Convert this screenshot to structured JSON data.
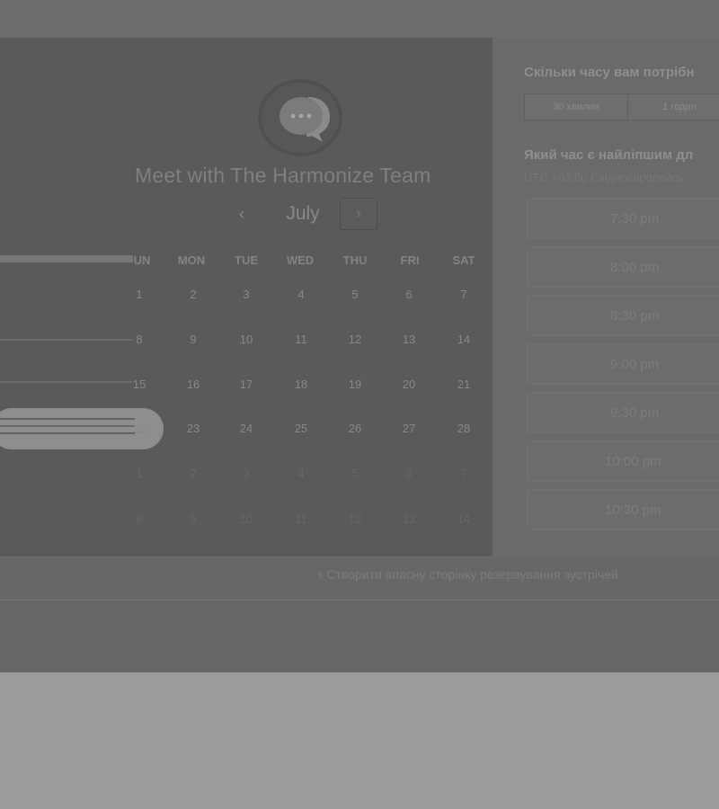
{
  "calendar": {
    "title": "Meet with The Harmonize Team",
    "month": "July",
    "prev_icon": "‹",
    "next_icon": "›",
    "weekdays": [
      "UN",
      "MON",
      "TUE",
      "WED",
      "THU",
      "FRI",
      "SAT"
    ],
    "weeks": [
      [
        "1",
        "2",
        "3",
        "4",
        "5",
        "6",
        "7"
      ],
      [
        "8",
        "9",
        "10",
        "11",
        "12",
        "13",
        "14"
      ],
      [
        "15",
        "16",
        "17",
        "18",
        "19",
        "20",
        "21"
      ],
      [
        "22",
        "23",
        "24",
        "25",
        "26",
        "27",
        "28"
      ],
      [
        "1",
        "2",
        "3",
        "4",
        "5",
        "6",
        "7"
      ],
      [
        "8",
        "9",
        "10",
        "11",
        "12",
        "13",
        "14"
      ]
    ],
    "selected_day": "22"
  },
  "booking": {
    "duration_question": "Скільки часу вам потрібн",
    "durations": [
      "30 хвилин",
      "1 годин"
    ],
    "time_question": "Який час є найліпшим дл",
    "timezone": "UTC +03:00 Східноєвропейсь",
    "slots": [
      "7:30 pm",
      "8:00 pm",
      "8:30 pm",
      "9:00 pm",
      "9:30 pm",
      "10:00 pm",
      "10:30 pm"
    ]
  },
  "footer": {
    "create_link": "Створити власну сторінку резервування зустрічей"
  },
  "colors": {
    "overlay_bg": "#6a6a6a",
    "panel_bg": "#5a5a5a",
    "selected_pill": "#8e8e8e"
  }
}
